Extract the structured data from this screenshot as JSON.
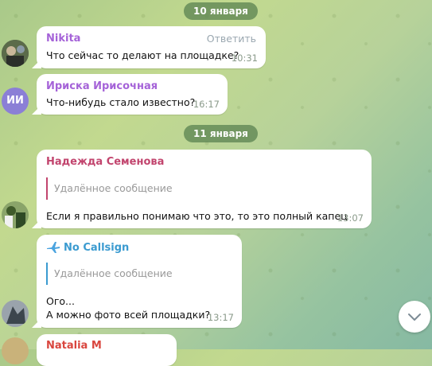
{
  "dates": {
    "first": "10 января",
    "second": "11 января"
  },
  "messages": [
    {
      "author": "Nikita",
      "author_color": "#a563d8",
      "text": "Что сейчас то делают на площадке?",
      "time": "10:31",
      "reply": "Ответить"
    },
    {
      "author": "Ириска Ирисочная",
      "author_color": "#a563d8",
      "avatar_initials": "ИИ",
      "avatar_color": "#8b7fd6",
      "text": "Что-нибудь стало известно?",
      "time": "16:17"
    },
    {
      "author": "Надежда Семенова",
      "author_color": "#c2456e",
      "quote": "Удалённое сообщение",
      "quote_color": "#c2456e",
      "text": "Если я правильно понимаю что это, то это полный капец",
      "time": "13:07"
    },
    {
      "author": "No Callsign",
      "author_icon": "airplane-icon",
      "author_color": "#3b9bd0",
      "quote": "Удалённое сообщение",
      "quote_color": "#3b9bd0",
      "text_line1": "Ого...",
      "text_line2": "А можно фото всей площадки?",
      "time": "13:17"
    },
    {
      "author": "Natalia M",
      "author_color": "#d9463e"
    }
  ],
  "icons": {
    "scroll_down": "chevron-down-icon"
  }
}
